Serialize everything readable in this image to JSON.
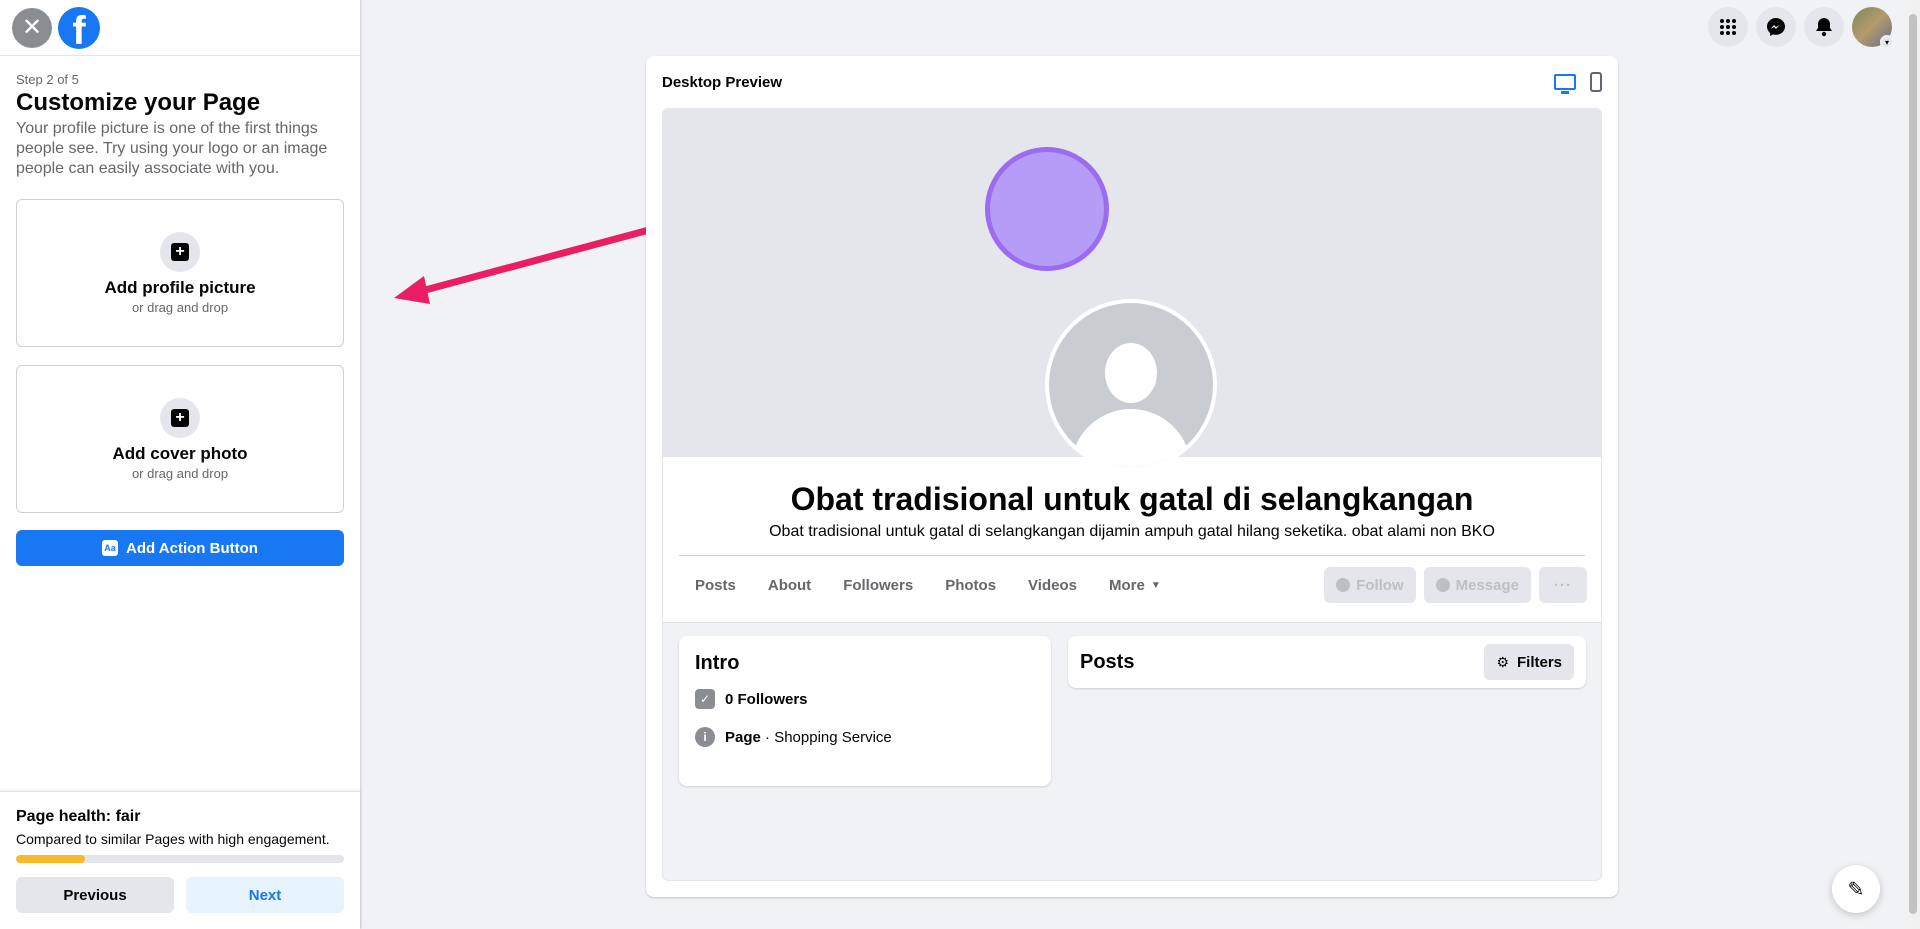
{
  "left_panel": {
    "step": "Step 2 of 5",
    "title": "Customize your Page",
    "description": "Your profile picture is one of the first things people see. Try using your logo or an image people can easily associate with you.",
    "profile_upload": {
      "title": "Add profile picture",
      "subtitle": "or drag and drop"
    },
    "cover_upload": {
      "title": "Add cover photo",
      "subtitle": "or drag and drop"
    },
    "action_button_label": "Add Action Button",
    "action_icon_text": "Aa"
  },
  "footer": {
    "health_title": "Page health: fair",
    "health_desc": "Compared to similar Pages with high engagement.",
    "health_progress": 0.21,
    "previous_label": "Previous",
    "next_label": "Next"
  },
  "preview": {
    "title": "Desktop Preview",
    "page_name": "Obat tradisional untuk gatal di selangkangan",
    "page_desc": "Obat tradisional untuk gatal di selangkangan dijamin ampuh gatal hilang seketika. obat alami non BKO",
    "tabs": [
      "Posts",
      "About",
      "Followers",
      "Photos",
      "Videos",
      "More"
    ],
    "follow_label": "Follow",
    "message_label": "Message",
    "more_actions_label": "···",
    "intro_title": "Intro",
    "followers_text": "0 Followers",
    "page_type_bold": "Page",
    "page_type_rest": " · Shopping Service",
    "posts_title": "Posts",
    "filters_label": "Filters"
  },
  "colors": {
    "brand": "#1877f2",
    "health_bar": "#f7b928",
    "annotation_arrow": "#e91e63",
    "cover_circle": "#b49cf7"
  },
  "icons": {
    "close": "close-icon",
    "logo": "facebook-logo",
    "menu": "grid-menu-icon",
    "messenger": "messenger-icon",
    "notifications": "bell-icon",
    "compose": "compose-icon"
  }
}
